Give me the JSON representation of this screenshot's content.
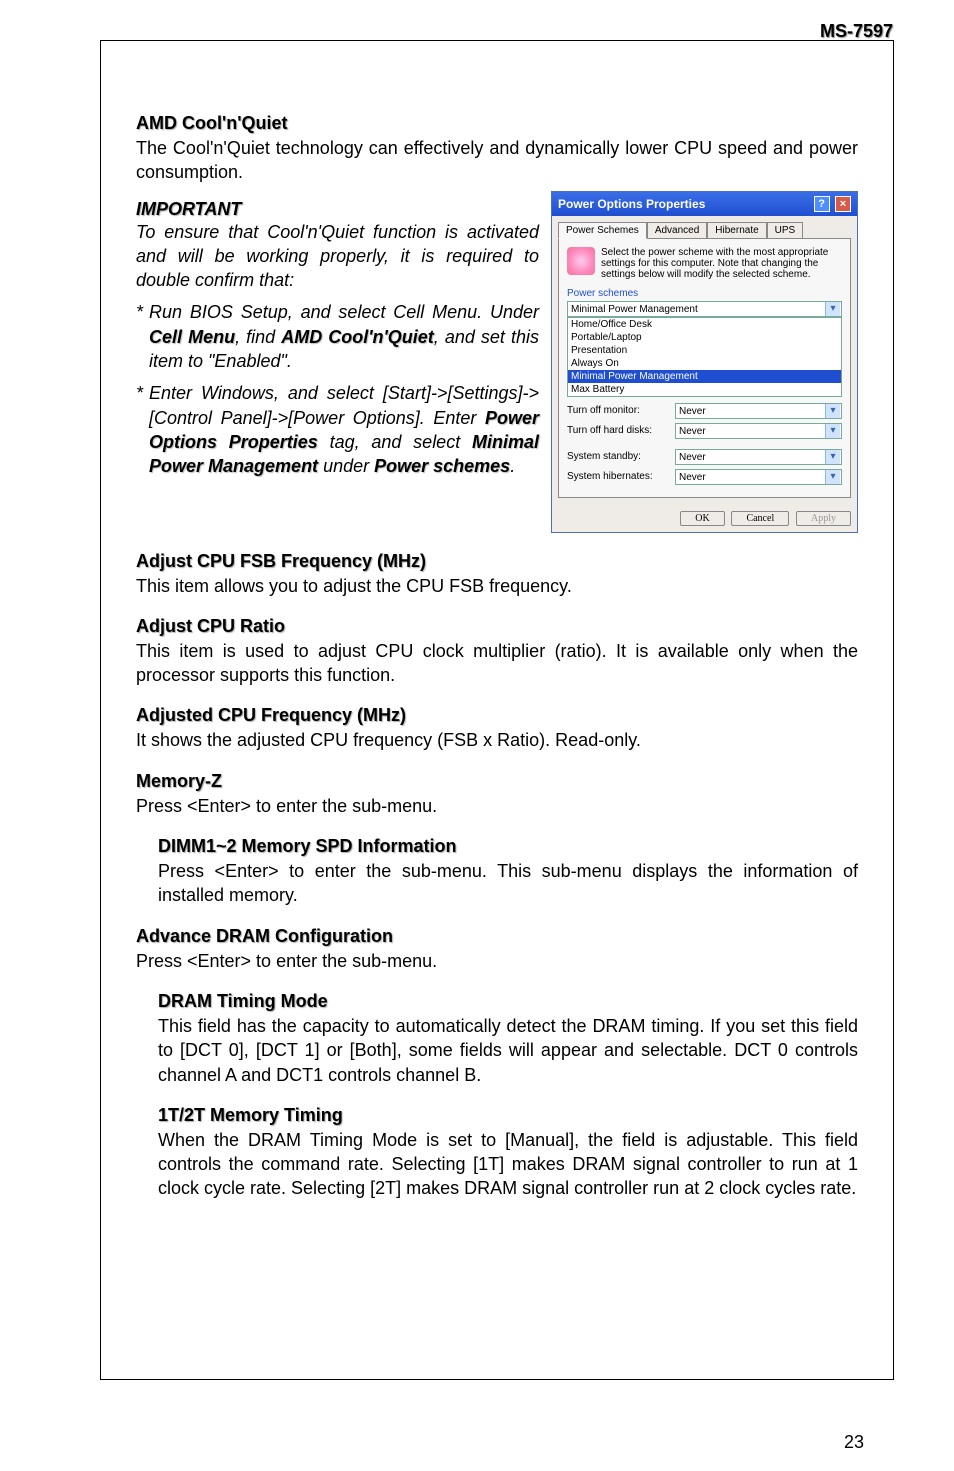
{
  "header": {
    "model": "MS-7597"
  },
  "s1": {
    "title": "AMD Cool'n'Quiet",
    "body": "The Cool'n'Quiet technology can effectively and dynamically lower CPU speed and  power consumption."
  },
  "important": {
    "title": "IMPORTANT",
    "intro": "To ensure that Cool'n'Quiet function is activated and will be working properly, it is required to double confirm that:",
    "b1_a": "Run BIOS Setup, and select Cell Menu. Under ",
    "b1_cell": "Cell Menu",
    "b1_b": ", find ",
    "b1_cnq": "AMD Cool'n'Quiet",
    "b1_c": ", and set this item to \"Enabled\".",
    "b2_a": "Enter Windows, and select [Start]->[Settings]->[Control Panel]->[Power Options]. Enter ",
    "b2_pop": "Power Options Properties",
    "b2_b": " tag, and select ",
    "b2_mpm": "Minimal Power Management",
    "b2_c": " under ",
    "b2_ps": "Power schemes",
    "b2_d": "."
  },
  "dialog": {
    "title": "Power Options Properties",
    "tabs": {
      "t1": "Power Schemes",
      "t2": "Advanced",
      "t3": "Hibernate",
      "t4": "UPS"
    },
    "info": "Select the power scheme with the most appropriate settings for this computer. Note that changing the settings below will modify the selected scheme.",
    "group": "Power schemes",
    "combo_value": "Minimal Power Management",
    "list": {
      "i1": "Home/Office Desk",
      "i2": "Portable/Laptop",
      "i3": "Presentation",
      "i4": "Always On",
      "i5": "Minimal Power Management",
      "i6": "Max Battery"
    },
    "rows": {
      "monitor_l": "Turn off monitor:",
      "monitor_v": "Never",
      "disks_l": "Turn off hard disks:",
      "disks_v": "Never",
      "standby_l": "System standby:",
      "standby_v": "Never",
      "hib_l": "System hibernates:",
      "hib_v": "Never"
    },
    "btns": {
      "ok": "OK",
      "cancel": "Cancel",
      "apply": "Apply"
    }
  },
  "s2": {
    "title": "Adjust CPU FSB Frequency (MHz)",
    "body": "This item allows you to adjust the CPU FSB frequency."
  },
  "s3": {
    "title": "Adjust CPU Ratio",
    "body": "This item is used to adjust CPU clock multiplier (ratio). It is available only when the processor supports this function."
  },
  "s4": {
    "title": "Adjusted CPU Frequency (MHz)",
    "body": "It shows the adjusted CPU frequency (FSB x Ratio). Read-only."
  },
  "s5": {
    "title": "Memory-Z",
    "body": "Press <Enter> to enter the sub-menu."
  },
  "s5a": {
    "title": "DIMM1~2 Memory SPD Information",
    "body": "Press <Enter> to enter the sub-menu. This sub-menu displays the information of installed memory."
  },
  "s6": {
    "title": "Advance DRAM Configuration",
    "body": "Press <Enter> to enter the sub-menu."
  },
  "s6a": {
    "title": "DRAM Timing Mode",
    "body": "This field has the capacity to automatically detect the DRAM timing. If you set this field to [DCT 0], [DCT 1] or [Both], some fields will appear and selectable. DCT 0 controls channel A and DCT1 controls channel B."
  },
  "s6b": {
    "title": "1T/2T Memory Timing",
    "body": "When the DRAM Timing Mode is set to [Manual], the field is adjustable. This field controls the command rate. Selecting [1T] makes DRAM signal controller to run at 1 clock cycle rate. Selecting [2T] makes DRAM signal controller run at 2 clock cycles rate."
  },
  "page_number": "23"
}
